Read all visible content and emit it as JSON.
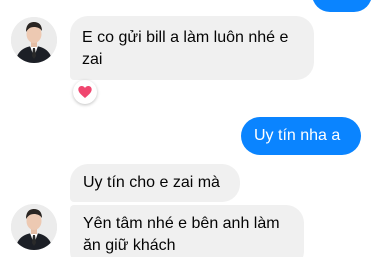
{
  "messages": [
    {
      "direction": "incoming",
      "text": "E co gửi bill a làm luôn nhé e zai"
    },
    {
      "direction": "outgoing",
      "text": "Uy tín nha a"
    },
    {
      "direction": "incoming",
      "text": "Uy tín cho e zai mà"
    },
    {
      "direction": "incoming",
      "text": "Yên tâm nhé e bên anh làm ăn giữ khách"
    }
  ],
  "reactions": [
    {
      "emoji_icon": "heart-icon",
      "color": "#f0466f"
    }
  ],
  "colors": {
    "outgoing_bubble": "#0a84ff",
    "incoming_bubble": "#f0f0f0"
  }
}
